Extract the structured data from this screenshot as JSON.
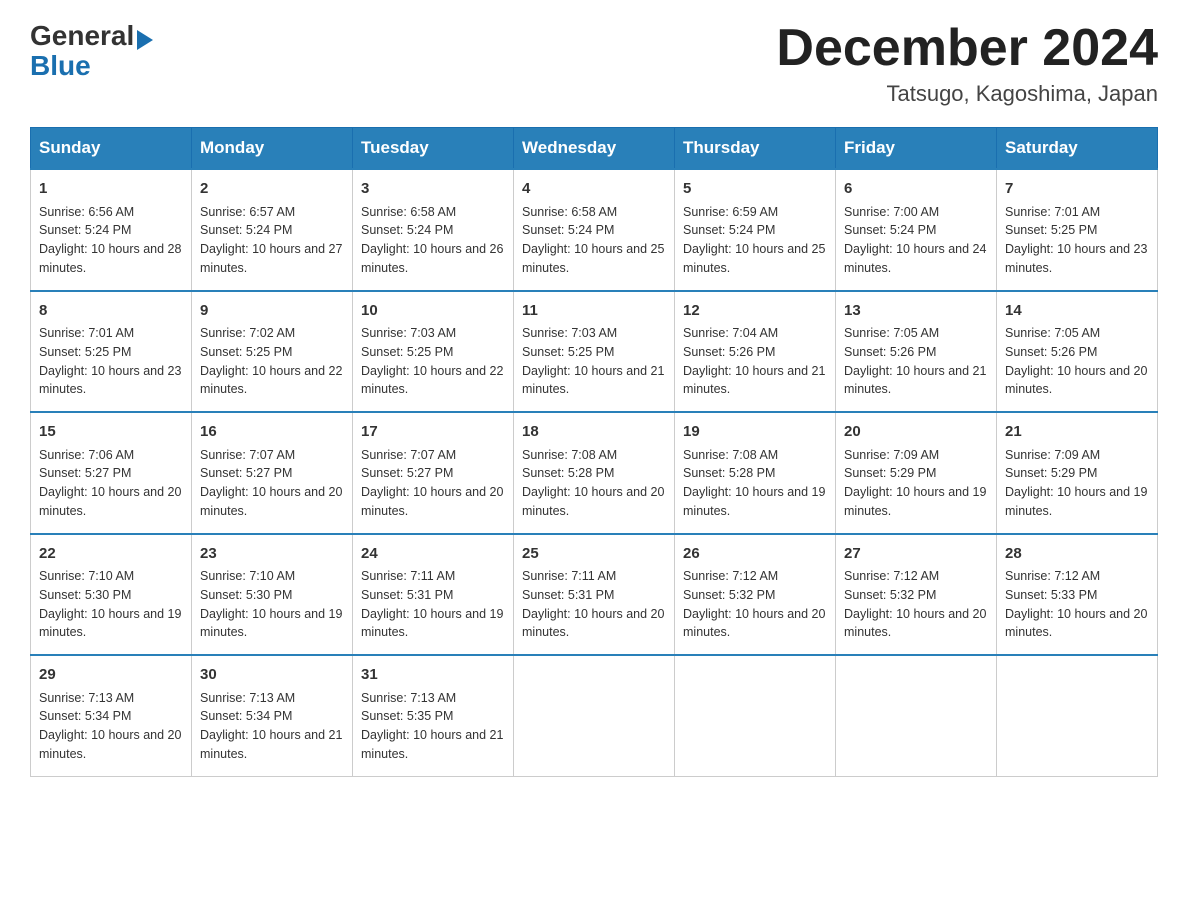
{
  "logo": {
    "general": "General",
    "arrow": "▶",
    "blue": "Blue"
  },
  "title": {
    "month": "December 2024",
    "location": "Tatsugo, Kagoshima, Japan"
  },
  "header_days": [
    "Sunday",
    "Monday",
    "Tuesday",
    "Wednesday",
    "Thursday",
    "Friday",
    "Saturday"
  ],
  "weeks": [
    [
      {
        "day": "1",
        "sunrise": "Sunrise: 6:56 AM",
        "sunset": "Sunset: 5:24 PM",
        "daylight": "Daylight: 10 hours and 28 minutes."
      },
      {
        "day": "2",
        "sunrise": "Sunrise: 6:57 AM",
        "sunset": "Sunset: 5:24 PM",
        "daylight": "Daylight: 10 hours and 27 minutes."
      },
      {
        "day": "3",
        "sunrise": "Sunrise: 6:58 AM",
        "sunset": "Sunset: 5:24 PM",
        "daylight": "Daylight: 10 hours and 26 minutes."
      },
      {
        "day": "4",
        "sunrise": "Sunrise: 6:58 AM",
        "sunset": "Sunset: 5:24 PM",
        "daylight": "Daylight: 10 hours and 25 minutes."
      },
      {
        "day": "5",
        "sunrise": "Sunrise: 6:59 AM",
        "sunset": "Sunset: 5:24 PM",
        "daylight": "Daylight: 10 hours and 25 minutes."
      },
      {
        "day": "6",
        "sunrise": "Sunrise: 7:00 AM",
        "sunset": "Sunset: 5:24 PM",
        "daylight": "Daylight: 10 hours and 24 minutes."
      },
      {
        "day": "7",
        "sunrise": "Sunrise: 7:01 AM",
        "sunset": "Sunset: 5:25 PM",
        "daylight": "Daylight: 10 hours and 23 minutes."
      }
    ],
    [
      {
        "day": "8",
        "sunrise": "Sunrise: 7:01 AM",
        "sunset": "Sunset: 5:25 PM",
        "daylight": "Daylight: 10 hours and 23 minutes."
      },
      {
        "day": "9",
        "sunrise": "Sunrise: 7:02 AM",
        "sunset": "Sunset: 5:25 PM",
        "daylight": "Daylight: 10 hours and 22 minutes."
      },
      {
        "day": "10",
        "sunrise": "Sunrise: 7:03 AM",
        "sunset": "Sunset: 5:25 PM",
        "daylight": "Daylight: 10 hours and 22 minutes."
      },
      {
        "day": "11",
        "sunrise": "Sunrise: 7:03 AM",
        "sunset": "Sunset: 5:25 PM",
        "daylight": "Daylight: 10 hours and 21 minutes."
      },
      {
        "day": "12",
        "sunrise": "Sunrise: 7:04 AM",
        "sunset": "Sunset: 5:26 PM",
        "daylight": "Daylight: 10 hours and 21 minutes."
      },
      {
        "day": "13",
        "sunrise": "Sunrise: 7:05 AM",
        "sunset": "Sunset: 5:26 PM",
        "daylight": "Daylight: 10 hours and 21 minutes."
      },
      {
        "day": "14",
        "sunrise": "Sunrise: 7:05 AM",
        "sunset": "Sunset: 5:26 PM",
        "daylight": "Daylight: 10 hours and 20 minutes."
      }
    ],
    [
      {
        "day": "15",
        "sunrise": "Sunrise: 7:06 AM",
        "sunset": "Sunset: 5:27 PM",
        "daylight": "Daylight: 10 hours and 20 minutes."
      },
      {
        "day": "16",
        "sunrise": "Sunrise: 7:07 AM",
        "sunset": "Sunset: 5:27 PM",
        "daylight": "Daylight: 10 hours and 20 minutes."
      },
      {
        "day": "17",
        "sunrise": "Sunrise: 7:07 AM",
        "sunset": "Sunset: 5:27 PM",
        "daylight": "Daylight: 10 hours and 20 minutes."
      },
      {
        "day": "18",
        "sunrise": "Sunrise: 7:08 AM",
        "sunset": "Sunset: 5:28 PM",
        "daylight": "Daylight: 10 hours and 20 minutes."
      },
      {
        "day": "19",
        "sunrise": "Sunrise: 7:08 AM",
        "sunset": "Sunset: 5:28 PM",
        "daylight": "Daylight: 10 hours and 19 minutes."
      },
      {
        "day": "20",
        "sunrise": "Sunrise: 7:09 AM",
        "sunset": "Sunset: 5:29 PM",
        "daylight": "Daylight: 10 hours and 19 minutes."
      },
      {
        "day": "21",
        "sunrise": "Sunrise: 7:09 AM",
        "sunset": "Sunset: 5:29 PM",
        "daylight": "Daylight: 10 hours and 19 minutes."
      }
    ],
    [
      {
        "day": "22",
        "sunrise": "Sunrise: 7:10 AM",
        "sunset": "Sunset: 5:30 PM",
        "daylight": "Daylight: 10 hours and 19 minutes."
      },
      {
        "day": "23",
        "sunrise": "Sunrise: 7:10 AM",
        "sunset": "Sunset: 5:30 PM",
        "daylight": "Daylight: 10 hours and 19 minutes."
      },
      {
        "day": "24",
        "sunrise": "Sunrise: 7:11 AM",
        "sunset": "Sunset: 5:31 PM",
        "daylight": "Daylight: 10 hours and 19 minutes."
      },
      {
        "day": "25",
        "sunrise": "Sunrise: 7:11 AM",
        "sunset": "Sunset: 5:31 PM",
        "daylight": "Daylight: 10 hours and 20 minutes."
      },
      {
        "day": "26",
        "sunrise": "Sunrise: 7:12 AM",
        "sunset": "Sunset: 5:32 PM",
        "daylight": "Daylight: 10 hours and 20 minutes."
      },
      {
        "day": "27",
        "sunrise": "Sunrise: 7:12 AM",
        "sunset": "Sunset: 5:32 PM",
        "daylight": "Daylight: 10 hours and 20 minutes."
      },
      {
        "day": "28",
        "sunrise": "Sunrise: 7:12 AM",
        "sunset": "Sunset: 5:33 PM",
        "daylight": "Daylight: 10 hours and 20 minutes."
      }
    ],
    [
      {
        "day": "29",
        "sunrise": "Sunrise: 7:13 AM",
        "sunset": "Sunset: 5:34 PM",
        "daylight": "Daylight: 10 hours and 20 minutes."
      },
      {
        "day": "30",
        "sunrise": "Sunrise: 7:13 AM",
        "sunset": "Sunset: 5:34 PM",
        "daylight": "Daylight: 10 hours and 21 minutes."
      },
      {
        "day": "31",
        "sunrise": "Sunrise: 7:13 AM",
        "sunset": "Sunset: 5:35 PM",
        "daylight": "Daylight: 10 hours and 21 minutes."
      },
      null,
      null,
      null,
      null
    ]
  ]
}
